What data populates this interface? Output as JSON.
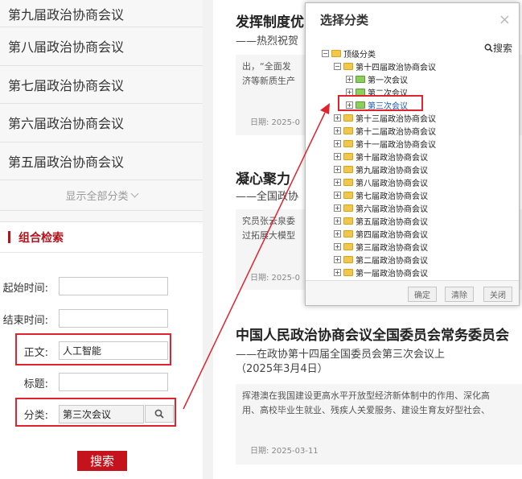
{
  "sidebar": {
    "categories": [
      "第九届政治协商会议",
      "第八届政治协商会议",
      "第七届政治协商会议",
      "第六届政治协商会议",
      "第五届政治协商会议"
    ],
    "show_all": "显示全部分类"
  },
  "search": {
    "title": "组合检索",
    "start_label": "起始时间:",
    "end_label": "结束时间:",
    "text_label": "正文:",
    "text_value": "人工智能",
    "title_label": "标题:",
    "category_label": "分类:",
    "category_value": "第三次会议",
    "button": "搜索"
  },
  "articles": [
    {
      "title": "发挥制度优",
      "subtitle": "——热烈祝贺",
      "line1": "出，“全面发",
      "line2": "济等新质生产",
      "date": "日期:  2025-0"
    },
    {
      "title": "凝心聚力 ",
      "subtitle": "——全国政协",
      "line1": "究员张云泉委",
      "line2": "过拓展大模型",
      "date": "日期:  2025-0"
    },
    {
      "title": "中国人民政治协商会议全国委员会常务委员会",
      "subtitle": "——在政协第十四届全国委员会第三次会议上",
      "subtitle2": "（2025年3月4日）",
      "line1": "挥港澳在我国建设更高水平开放型经济新体制中的作用、深化高",
      "line2": "用、高校毕业生就业、残疾人关爱服务、建设生育友好型社会、",
      "date": "日期:  2025-03-11"
    }
  ],
  "dialog": {
    "title": "选择分类",
    "close": "×",
    "search": "搜索",
    "tree": [
      {
        "label": "顶级分类",
        "level": 0,
        "toggle": "−"
      },
      {
        "label": "第十四届政治协商会议",
        "level": 1,
        "toggle": "−"
      },
      {
        "label": "第一次会议",
        "level": 2,
        "toggle": "+"
      },
      {
        "label": "第二次会议",
        "level": 2,
        "toggle": "+"
      },
      {
        "label": "第三次会议",
        "level": 2,
        "toggle": "+",
        "selected": true
      },
      {
        "label": "第十三届政治协商会议",
        "level": 1,
        "toggle": "+"
      },
      {
        "label": "第十二届政治协商会议",
        "level": 1,
        "toggle": "+"
      },
      {
        "label": "第十一届政治协商会议",
        "level": 1,
        "toggle": "+"
      },
      {
        "label": "第十届政治协商会议",
        "level": 1,
        "toggle": "+"
      },
      {
        "label": "第九届政治协商会议",
        "level": 1,
        "toggle": "+"
      },
      {
        "label": "第八届政治协商会议",
        "level": 1,
        "toggle": "+"
      },
      {
        "label": "第七届政治协商会议",
        "level": 1,
        "toggle": "+"
      },
      {
        "label": "第六届政治协商会议",
        "level": 1,
        "toggle": "+"
      },
      {
        "label": "第五届政治协商会议",
        "level": 1,
        "toggle": "+"
      },
      {
        "label": "第四届政治协商会议",
        "level": 1,
        "toggle": "+"
      },
      {
        "label": "第三届政治协商会议",
        "level": 1,
        "toggle": "+"
      },
      {
        "label": "第二届政治协商会议",
        "level": 1,
        "toggle": "+"
      },
      {
        "label": "第一届政治协商会议",
        "level": 1,
        "toggle": "+"
      }
    ],
    "confirm": "确定",
    "clear": "清除",
    "close_btn": "关闭"
  },
  "colors": {
    "accent": "#c4131c",
    "highlight": "#e0242f",
    "link": "#1a5bb5"
  }
}
